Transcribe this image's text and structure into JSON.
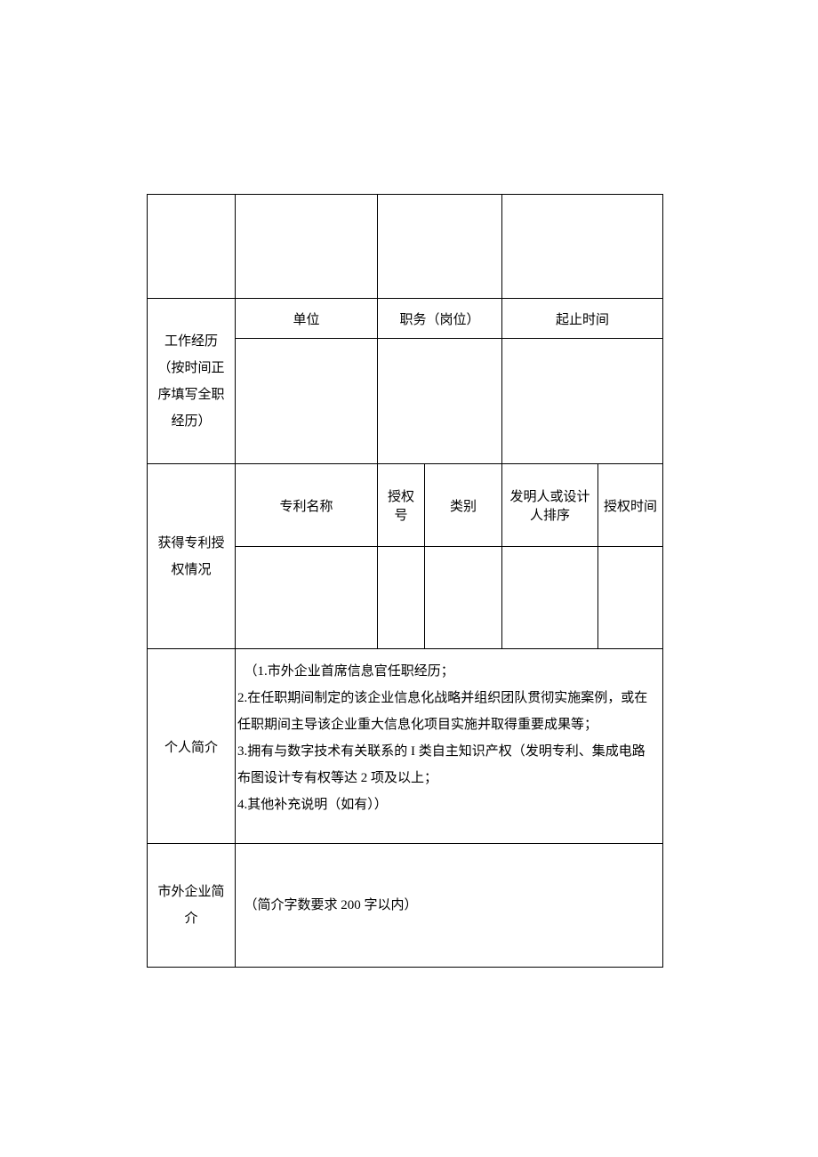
{
  "labels": {
    "work_history": "工作经历\n（按时间正\n序填写全职\n经历）",
    "patent_status": "获得专利授\n权情况",
    "personal_profile": "个人简介",
    "external_company": "市外企业简\n介"
  },
  "work_headers": {
    "unit": "单位",
    "position": "职务（岗位）",
    "time": "起止时间"
  },
  "patent_headers": {
    "name": "专利名称",
    "auth_no": "授权\n号",
    "category": "类别",
    "inventor": "发明人或设计\n人排序",
    "auth_time": "授权时间"
  },
  "profile_text": "　（1.市外企业首席信息官任职经历；\n2.在任职期间制定的该企业信息化战略并组织团队贯彻实施案例，或在任职期间主导该企业重大信息化项目实施并取得重要成果等；\n3.拥有与数字技术有关联系的 I 类自主知识产权（发明专利、集成电路布图设计专有权等达 2 项及以上；\n4.其他补充说明（如有））",
  "company_text": "　（简介字数要求 200 字以内）"
}
